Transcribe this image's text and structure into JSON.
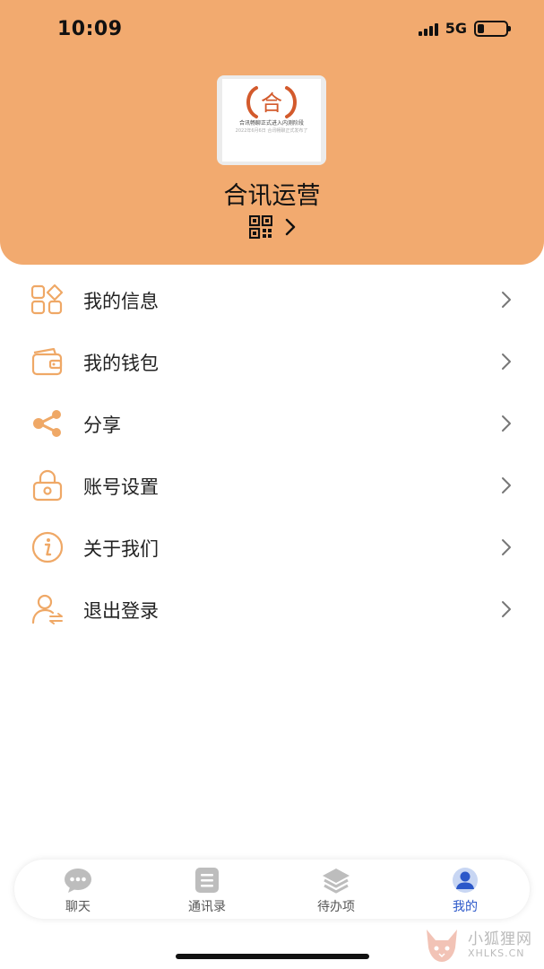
{
  "status_bar": {
    "time": "10:09",
    "network": "5G"
  },
  "profile": {
    "name": "合讯运营",
    "avatar_logo": "合",
    "avatar_caption": "合讯畅聊正式进入内测阶段",
    "avatar_subcaption": "2022年6月6日 合讯畅聊正式发布了"
  },
  "menu": {
    "items": [
      {
        "label": "我的信息",
        "icon": "grid-icon"
      },
      {
        "label": "我的钱包",
        "icon": "wallet-icon"
      },
      {
        "label": "分享",
        "icon": "share-icon"
      },
      {
        "label": "账号设置",
        "icon": "lock-icon"
      },
      {
        "label": "关于我们",
        "icon": "info-icon"
      },
      {
        "label": "退出登录",
        "icon": "user-switch-icon"
      }
    ]
  },
  "tabbar": {
    "tabs": [
      {
        "label": "聊天",
        "icon": "chat-icon",
        "active": false
      },
      {
        "label": "通讯录",
        "icon": "contacts-icon",
        "active": false
      },
      {
        "label": "待办项",
        "icon": "layers-icon",
        "active": false
      },
      {
        "label": "我的",
        "icon": "person-icon",
        "active": true
      }
    ]
  },
  "watermark": {
    "line1": "小狐狸网",
    "line2": "XHLKS.CN"
  },
  "colors": {
    "header": "#f2aa6f",
    "icon": "#efa866",
    "active_tab": "#2c58c9",
    "logo_red": "#d35a2c"
  }
}
